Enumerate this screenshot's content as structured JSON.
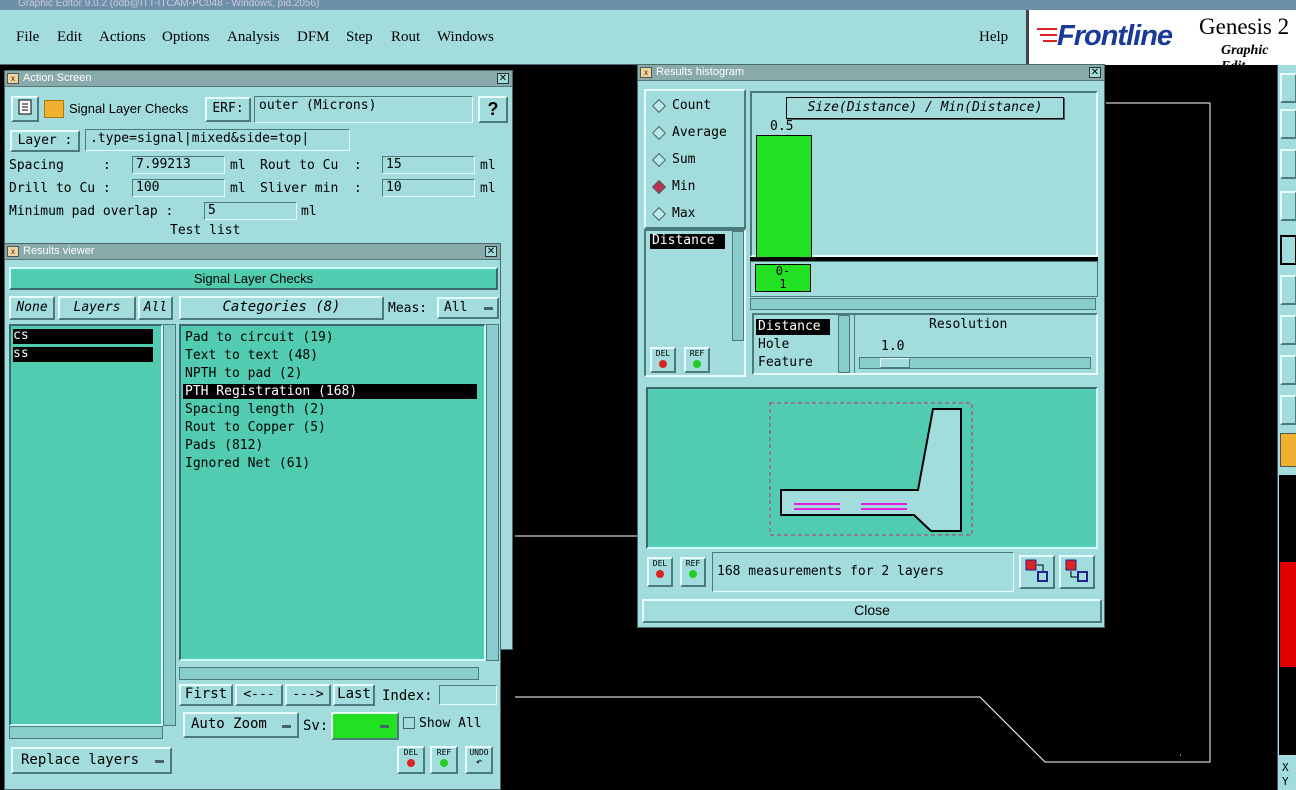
{
  "app": {
    "title": "Graphic Editor 9.0.2 (odb@ITT-ITCAM-PC048 - Windows, pid.2056)",
    "menu": [
      "File",
      "Edit",
      "Actions",
      "Options",
      "Analysis",
      "DFM",
      "Step",
      "Rout",
      "Windows"
    ],
    "help": "Help",
    "brand": "Frontline",
    "product": "Genesis 2",
    "product_sub": "Graphic Edit"
  },
  "action_screen": {
    "title": "Action Screen",
    "action_name": "Signal Layer Checks",
    "erf_label": "ERF:",
    "erf_value": "outer (Microns)",
    "help_btn": "?",
    "layer_label": "Layer :",
    "layer_value": ".type=signal|mixed&side=top|",
    "spacing_label": "Spacing     :",
    "spacing_value": "7.99213",
    "spacing_unit": "ml",
    "rout_label": "Rout to Cu  :",
    "rout_value": "15",
    "rout_unit": "ml",
    "drill_label": "Drill to Cu :",
    "drill_value": "100",
    "drill_unit": "ml",
    "sliver_label": "Sliver min  :",
    "sliver_value": "10",
    "sliver_unit": "ml",
    "overlap_label": "Minimum pad overlap :",
    "overlap_value": "5",
    "overlap_unit": "ml",
    "test_list": "Test list"
  },
  "results_viewer": {
    "title": "Results viewer",
    "header": "Signal Layer Checks",
    "none_btn": "None",
    "layers_btn": "Layers",
    "all_btn": "All",
    "categories_btn": "Categories (8)",
    "meas_label": "Meas:",
    "meas_value": "All",
    "layers": [
      "cs",
      "ss"
    ],
    "categories": [
      "Pad to circuit (19)",
      "Text to text (48)",
      "NPTH to pad (2)",
      "PTH Registration (168)",
      "Spacing length (2)",
      "Rout to Copper (5)",
      "Pads (812)",
      "Ignored Net (61)"
    ],
    "selected_category": "PTH Registration (168)",
    "first_btn": "First",
    "prev_btn": "<---",
    "next_btn": "--->",
    "last_btn": "Last",
    "index_label": "Index:",
    "index_value": "",
    "zoom_value": "Auto Zoom",
    "sv_label": "Sv:",
    "show_all": "Show All",
    "replace_layers": "Replace layers",
    "del": "DEL",
    "ref": "REF",
    "undo": "UNDO"
  },
  "histogram": {
    "title": "Results histogram",
    "options": [
      "Count",
      "Average",
      "Sum",
      "Min",
      "Max"
    ],
    "selected_option": "Min",
    "measure_list": [
      "Distance"
    ],
    "formula": "Size(Distance) / Min(Distance)",
    "bar_label": "0.5",
    "bar_value": 0.5,
    "bin_label_top": "0-",
    "bin_label_bottom": "1",
    "res_list": [
      "Distance",
      "Hole",
      "Feature"
    ],
    "resolution_label": "Resolution",
    "resolution_value": "1.0",
    "status": "168 measurements for 2 layers",
    "close": "Close",
    "del": "DEL",
    "ref": "REF"
  },
  "colors": {
    "panel": "#a2dcdc",
    "list": "#52ccb0",
    "bar": "#22e022",
    "marker": "#e020e0"
  },
  "canvas": {
    "readout_x": "X",
    "readout_y": "Y"
  }
}
